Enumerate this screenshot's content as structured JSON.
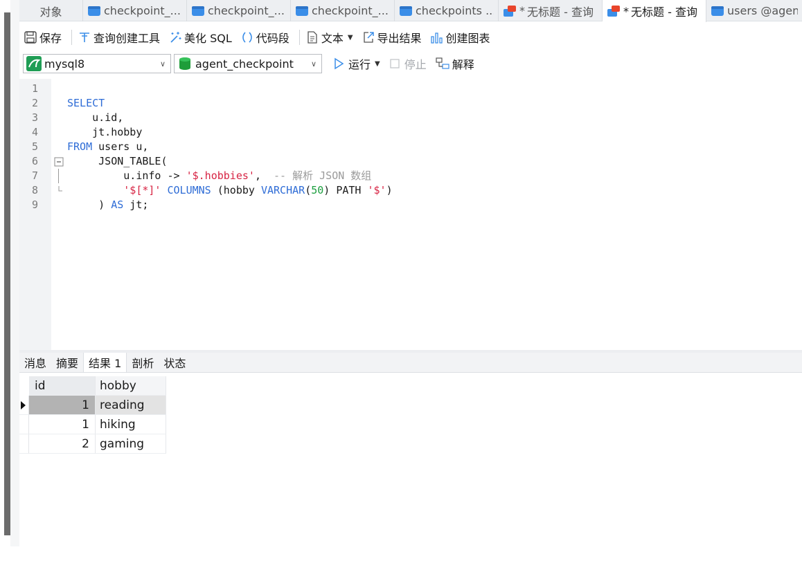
{
  "tabs": [
    {
      "label": "对象",
      "icon": "none",
      "active": false
    },
    {
      "label": "checkpoint_...",
      "icon": "table-icon"
    },
    {
      "label": "checkpoint_...",
      "icon": "table-icon"
    },
    {
      "label": "checkpoint_...",
      "icon": "table-icon"
    },
    {
      "label": "checkpoints ...",
      "icon": "table-icon"
    },
    {
      "label": "无标题 - 查询",
      "icon": "query-icon",
      "modified": "*"
    },
    {
      "label": "无标题 - 查询",
      "icon": "query-icon",
      "modified": "*",
      "active": true
    },
    {
      "label": "users @agen...",
      "icon": "table-icon"
    }
  ],
  "toolbar1": {
    "save": "保存",
    "query_builder": "查询创建工具",
    "beautify": "美化 SQL",
    "snippet": "代码段",
    "text": "文本",
    "export": "导出结果",
    "chart": "创建图表"
  },
  "toolbar2": {
    "connection": "mysql8",
    "database": "agent_checkpoint",
    "run": "运行",
    "stop": "停止",
    "explain": "解释"
  },
  "editor": {
    "line_numbers": [
      "1",
      "2",
      "3",
      "4",
      "5",
      "6",
      "7",
      "8",
      "9"
    ],
    "lines": [
      [],
      [
        [
          "kw",
          "SELECT"
        ]
      ],
      [
        [
          "id",
          "    u.id,"
        ]
      ],
      [
        [
          "id",
          "    jt.hobby"
        ]
      ],
      [
        [
          "kw",
          "FROM"
        ],
        [
          "id",
          " users u,"
        ]
      ],
      [
        [
          "id",
          "     JSON_TABLE("
        ]
      ],
      [
        [
          "id",
          "         u.info -> "
        ],
        [
          "str",
          "'$.hobbies'"
        ],
        [
          "id",
          ",  "
        ],
        [
          "cm",
          "-- 解析 JSON 数组"
        ]
      ],
      [
        [
          "id",
          "         "
        ],
        [
          "str",
          "'$[*]'"
        ],
        [
          "id",
          " "
        ],
        [
          "kw",
          "COLUMNS"
        ],
        [
          "id",
          " (hobby "
        ],
        [
          "kw",
          "VARCHAR"
        ],
        [
          "id",
          "("
        ],
        [
          "num",
          "50"
        ],
        [
          "id",
          ") PATH "
        ],
        [
          "str",
          "'$'"
        ],
        [
          "id",
          ")"
        ]
      ],
      [
        [
          "id",
          "     ) "
        ],
        [
          "kw",
          "AS"
        ],
        [
          "id",
          " jt;"
        ]
      ]
    ]
  },
  "result_tabs": [
    "消息",
    "摘要",
    "结果 1",
    "剖析",
    "状态"
  ],
  "result_grid": {
    "columns": [
      "id",
      "hobby"
    ],
    "rows": [
      [
        "1",
        "reading"
      ],
      [
        "1",
        "hiking"
      ],
      [
        "2",
        "gaming"
      ]
    ]
  },
  "colors": {
    "keyword": "#2e6cd6",
    "string": "#d72343",
    "number": "#1b9e3e",
    "comment": "#9b9b9b",
    "selected_cell": "#b3b3b3"
  }
}
